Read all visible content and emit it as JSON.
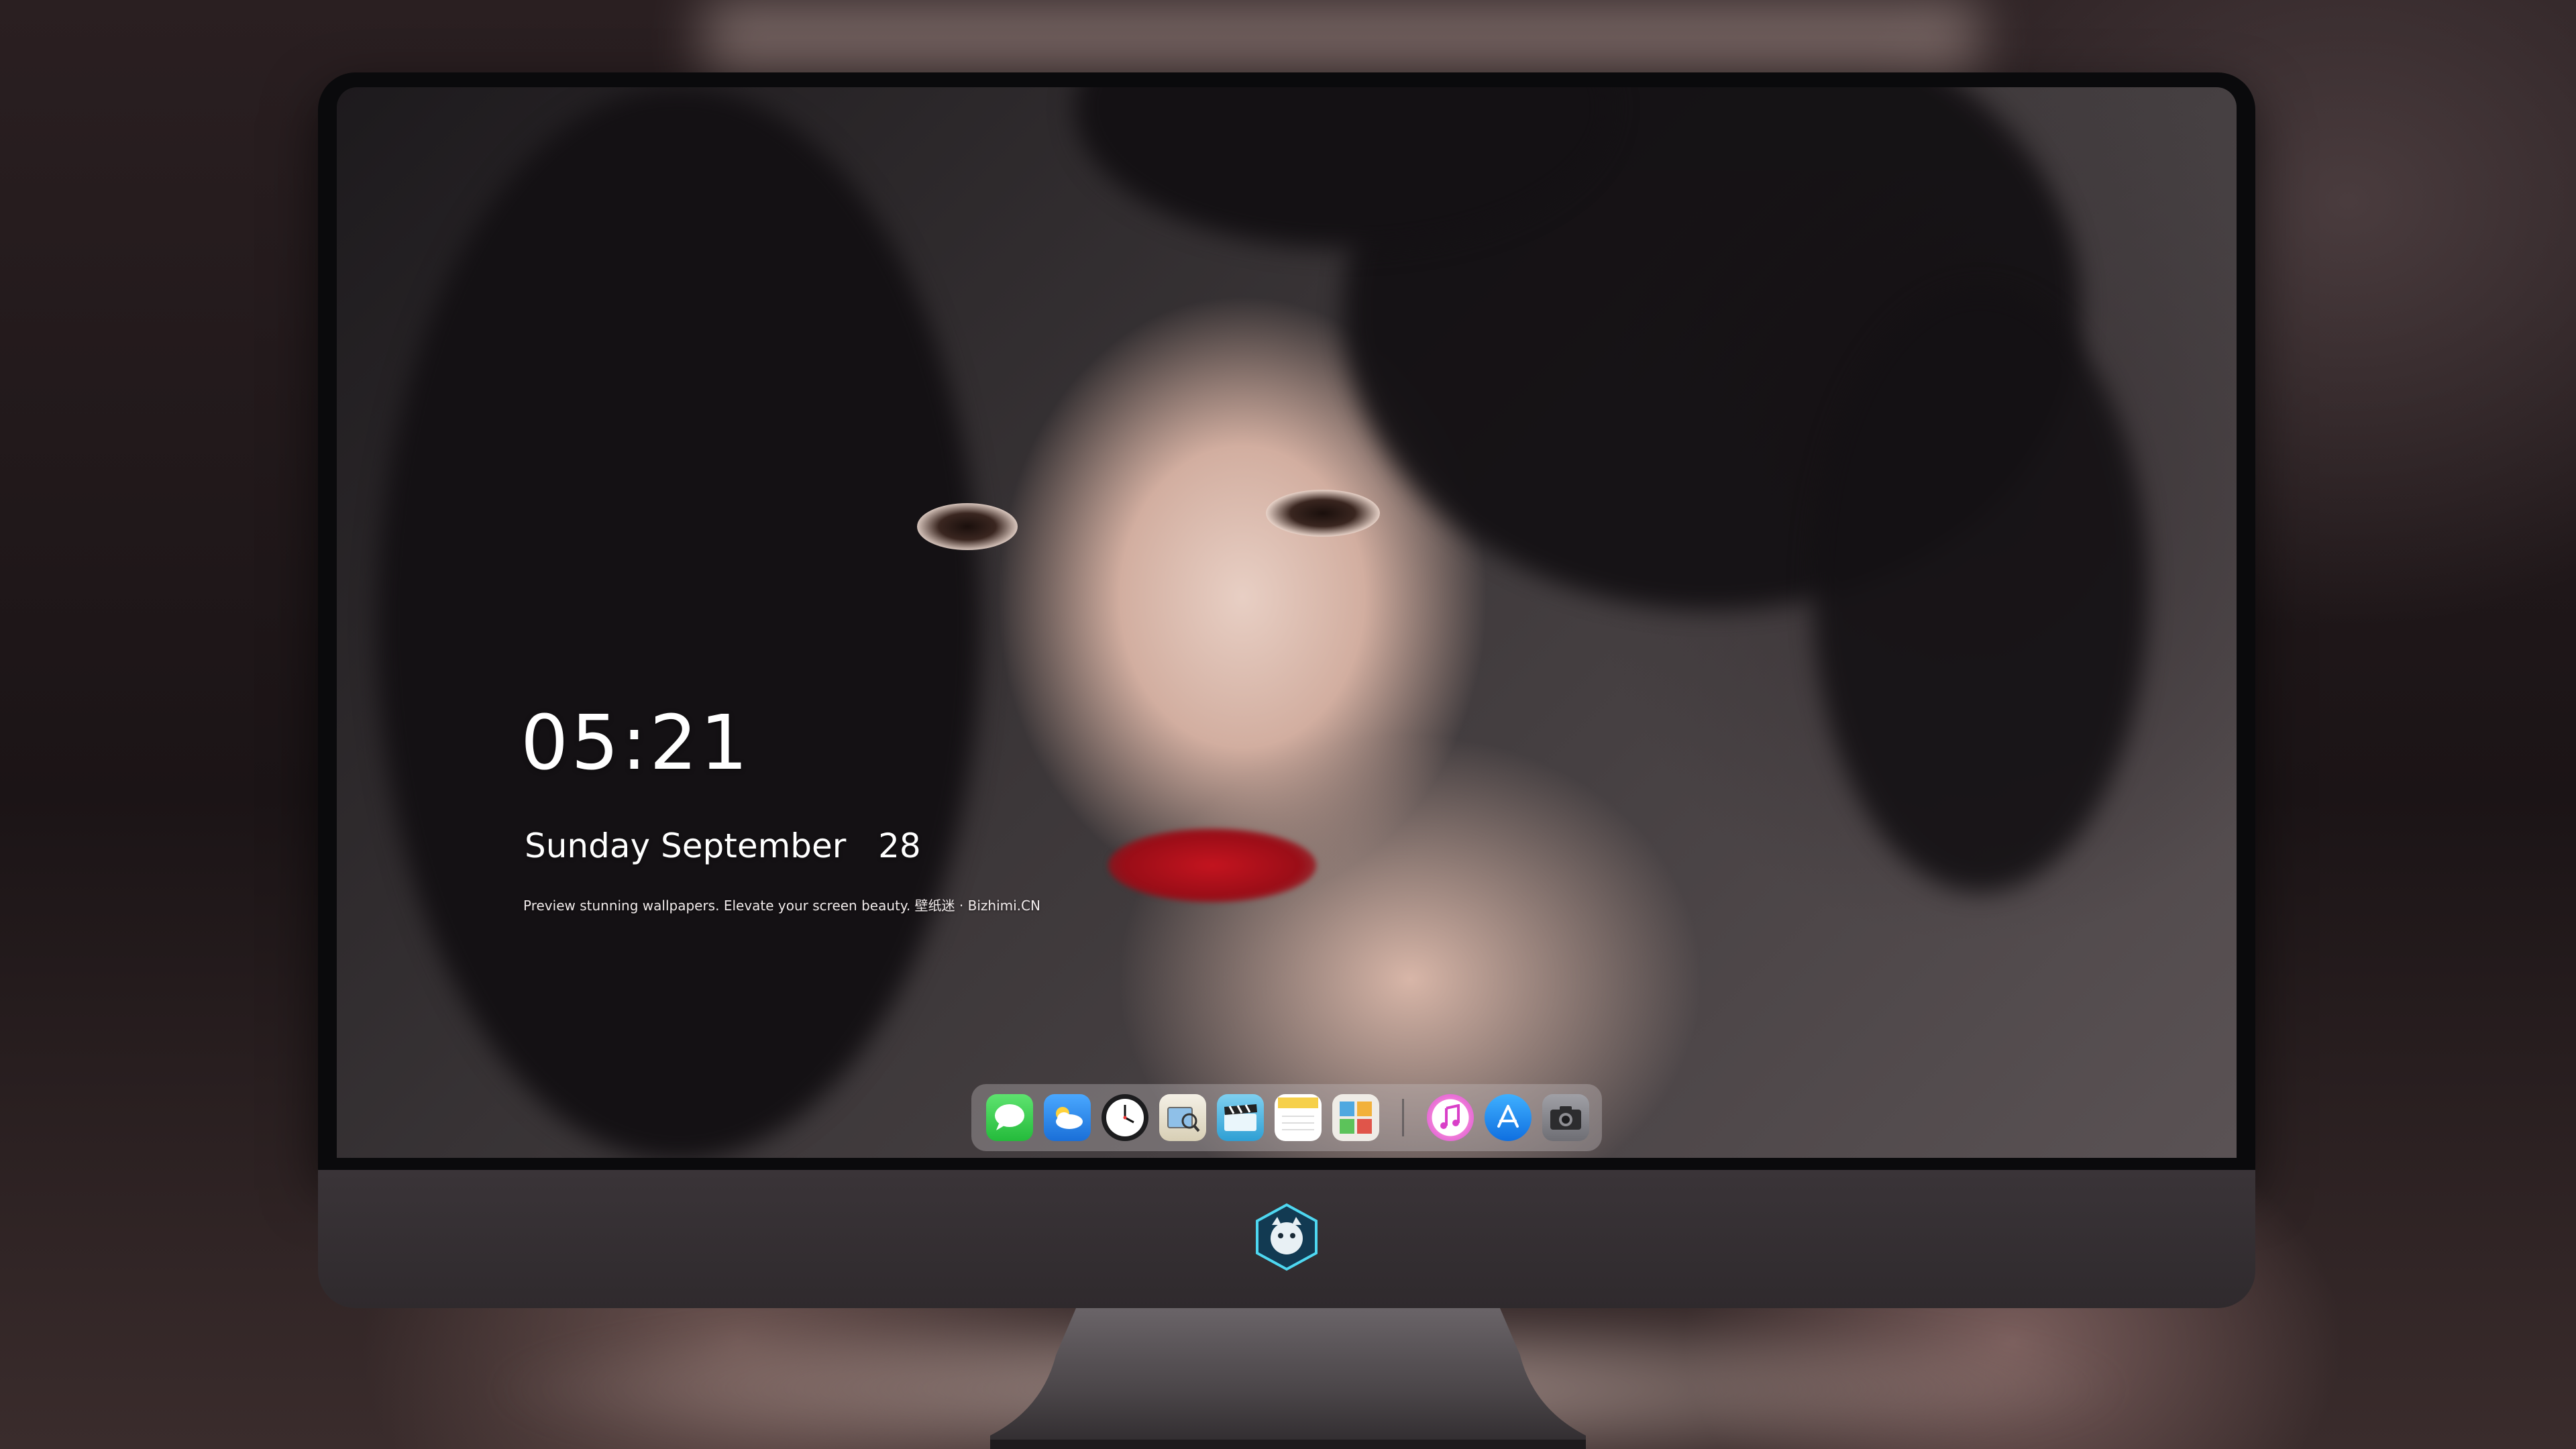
{
  "lock_screen": {
    "time": "05:21",
    "weekday": "Sunday",
    "month": "September",
    "day": "28",
    "tagline": "Preview stunning wallpapers. Elevate your screen beauty. 壁纸迷 · Bizhimi.CN"
  },
  "dock": {
    "apps": [
      {
        "name": "messages-icon",
        "color": "#3ad24f"
      },
      {
        "name": "weather-icon",
        "color": "#2a8ff0"
      },
      {
        "name": "clock-icon",
        "color": "#ffffff"
      },
      {
        "name": "preview-icon",
        "color": "#e6d27a"
      },
      {
        "name": "clips-icon",
        "color": "#4fb8e8"
      },
      {
        "name": "notes-icon",
        "color": "#f6d65a"
      },
      {
        "name": "photo-booth-icon",
        "color": "#e8e4dc"
      },
      {
        "name": "music-icon",
        "color": "#e04fd0"
      },
      {
        "name": "app-store-icon",
        "color": "#1b8cf2"
      },
      {
        "name": "camera-icon",
        "color": "#8e8e93"
      }
    ]
  }
}
